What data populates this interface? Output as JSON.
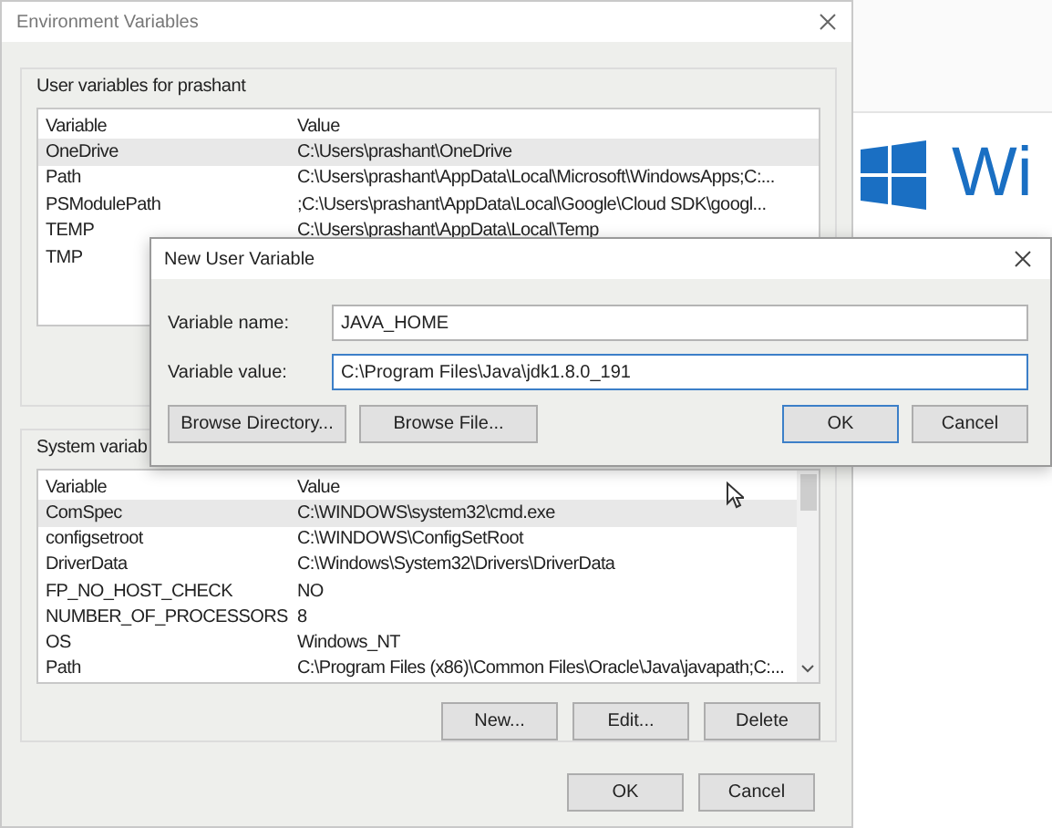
{
  "main_dialog": {
    "title": "Environment Variables",
    "user_section": {
      "label": "User variables for prashant",
      "columns": [
        "Variable",
        "Value"
      ],
      "rows": [
        {
          "variable": "OneDrive",
          "value": "C:\\Users\\prashant\\OneDrive",
          "selected": true
        },
        {
          "variable": "Path",
          "value": "C:\\Users\\prashant\\AppData\\Local\\Microsoft\\WindowsApps;C:...",
          "selected": false
        },
        {
          "variable": "PSModulePath",
          "value": ";C:\\Users\\prashant\\AppData\\Local\\Google\\Cloud SDK\\googl...",
          "selected": false
        },
        {
          "variable": "TEMP",
          "value": "C:\\Users\\prashant\\AppData\\Local\\Temp",
          "selected": false
        },
        {
          "variable": "TMP",
          "selected": false
        }
      ]
    },
    "system_section": {
      "label": "System variab",
      "columns": [
        "Variable",
        "Value"
      ],
      "rows": [
        {
          "variable": "ComSpec",
          "value": "C:\\WINDOWS\\system32\\cmd.exe",
          "selected": true
        },
        {
          "variable": "configsetroot",
          "value": "C:\\WINDOWS\\ConfigSetRoot",
          "selected": false
        },
        {
          "variable": "DriverData",
          "value": "C:\\Windows\\System32\\Drivers\\DriverData",
          "selected": false
        },
        {
          "variable": "FP_NO_HOST_CHECK",
          "value": "NO",
          "selected": false
        },
        {
          "variable": "NUMBER_OF_PROCESSORS",
          "value": "8",
          "selected": false
        },
        {
          "variable": "OS",
          "value": "Windows_NT",
          "selected": false
        },
        {
          "variable": "Path",
          "value": "C:\\Program Files (x86)\\Common Files\\Oracle\\Java\\javapath;C:...",
          "selected": false
        }
      ],
      "buttons": [
        "New...",
        "Edit...",
        "Delete"
      ]
    },
    "buttons": [
      "OK",
      "Cancel"
    ]
  },
  "new_variable_dialog": {
    "title": "New User Variable",
    "fields": [
      {
        "label": "Variable name:",
        "value": "JAVA_HOME",
        "focused": false
      },
      {
        "label": "Variable value:",
        "value": "C:\\Program Files\\Java\\jdk1.8.0_191",
        "focused": true
      }
    ],
    "buttons": [
      {
        "label": "Browse Directory...",
        "default": false
      },
      {
        "label": "Browse File...",
        "default": false
      },
      {
        "label": "OK",
        "default": true
      },
      {
        "label": "Cancel",
        "default": false
      }
    ]
  },
  "background": {
    "logo_text": "Wi"
  }
}
